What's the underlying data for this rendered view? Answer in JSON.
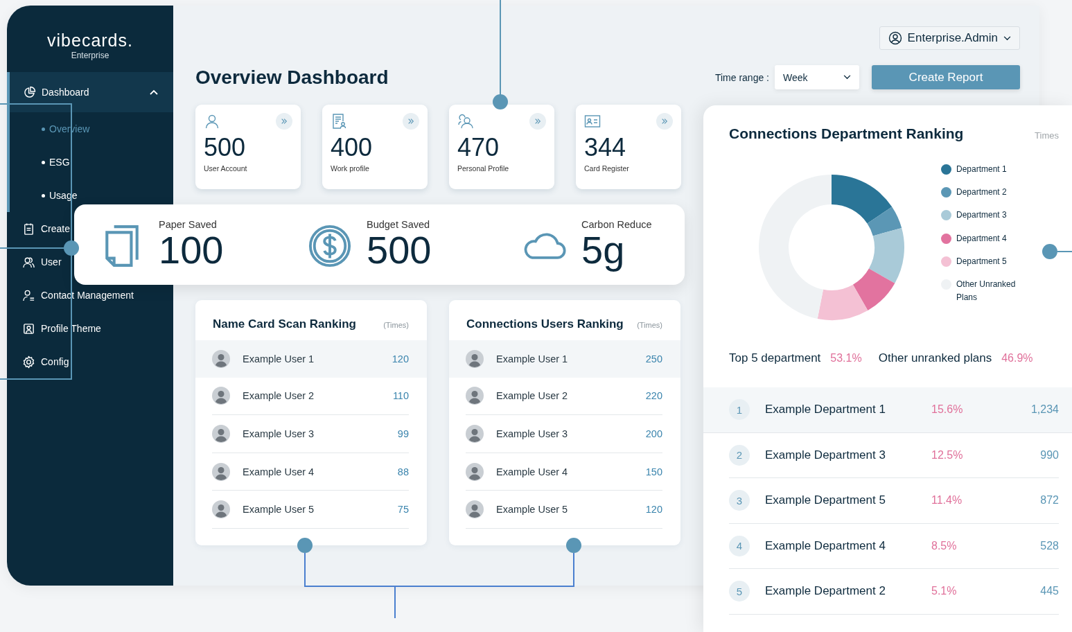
{
  "brand": {
    "name": "vibecards.",
    "edition": "Enterprise"
  },
  "sidebar": {
    "items": [
      {
        "label": "Dashboard",
        "expanded": true,
        "children": [
          {
            "label": "Overview",
            "selected": true
          },
          {
            "label": "ESG",
            "selected": false
          },
          {
            "label": "Usage",
            "selected": false
          }
        ]
      },
      {
        "label": "Create"
      },
      {
        "label": "User"
      },
      {
        "label": "Contact Management"
      },
      {
        "label": "Profile Theme"
      },
      {
        "label": "Config"
      }
    ]
  },
  "header": {
    "title": "Overview Dashboard",
    "account": "Enterprise.Admin",
    "time_range_label": "Time range :",
    "time_range_value": "Week",
    "create_button": "Create Report"
  },
  "summary_cards": [
    {
      "value": "500",
      "label": "User Account"
    },
    {
      "value": "400",
      "label": "Work profile"
    },
    {
      "value": "470",
      "label": "Personal Profile"
    },
    {
      "value": "344",
      "label": "Card Register"
    }
  ],
  "savings": [
    {
      "label": "Paper Saved",
      "value": "100"
    },
    {
      "label": "Budget Saved",
      "value": "500"
    },
    {
      "label": "Carbon Reduce",
      "value": "5g"
    }
  ],
  "rankings": [
    {
      "title": "Name Card Scan Ranking",
      "unit": "(Times)",
      "rows": [
        {
          "name": "Example User 1",
          "value": "120",
          "selected": true
        },
        {
          "name": "Example User 2",
          "value": "110",
          "selected": false
        },
        {
          "name": "Example User 3",
          "value": "99",
          "selected": false
        },
        {
          "name": "Example User 4",
          "value": "88",
          "selected": false
        },
        {
          "name": "Example User 5",
          "value": "75",
          "selected": false
        }
      ]
    },
    {
      "title": "Connections Users Ranking",
      "unit": "(Times)",
      "rows": [
        {
          "name": "Example User 1",
          "value": "250",
          "selected": true
        },
        {
          "name": "Example User 2",
          "value": "220",
          "selected": false
        },
        {
          "name": "Example User 3",
          "value": "200",
          "selected": false
        },
        {
          "name": "Example User 4",
          "value": "150",
          "selected": false
        },
        {
          "name": "Example User 5",
          "value": "120",
          "selected": false
        }
      ]
    }
  ],
  "department_panel": {
    "title": "Connections Department Ranking",
    "unit": "Times",
    "chart_data": {
      "type": "donut",
      "values": [
        15.6,
        5.1,
        12.5,
        8.5,
        11.4,
        46.9
      ]
    },
    "legend": [
      {
        "label": "Department 1",
        "color": "#2a7597"
      },
      {
        "label": "Department 2",
        "color": "#5b97b5"
      },
      {
        "label": "Department 3",
        "color": "#a9cad8"
      },
      {
        "label": "Department 4",
        "color": "#e2739f"
      },
      {
        "label": "Department 5",
        "color": "#f4c1d4"
      },
      {
        "label": "Other Unranked Plans",
        "color": "#eff2f4"
      }
    ],
    "summary": [
      {
        "label": "Top 5 department",
        "value": "53.1%"
      },
      {
        "label": "Other unranked plans",
        "value": "46.9%"
      }
    ],
    "departments": [
      {
        "rank": "1",
        "name": "Example Department 1",
        "share": "15.6%",
        "count": "1,234",
        "selected": true
      },
      {
        "rank": "2",
        "name": "Example Department 3",
        "share": "12.5%",
        "count": "990",
        "selected": false
      },
      {
        "rank": "3",
        "name": "Example Department 5",
        "share": "11.4%",
        "count": "872",
        "selected": false
      },
      {
        "rank": "4",
        "name": "Example Department 4",
        "share": "8.5%",
        "count": "528",
        "selected": false
      },
      {
        "rank": "5",
        "name": "Example Department 2",
        "share": "5.1%",
        "count": "445",
        "selected": false
      }
    ]
  }
}
